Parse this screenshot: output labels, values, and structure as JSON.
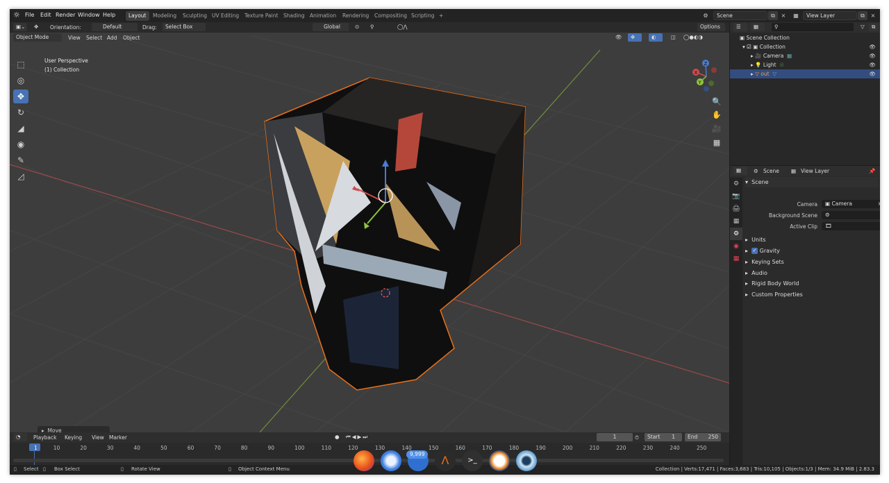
{
  "topbar": {
    "menus": [
      "File",
      "Edit",
      "Render",
      "Window",
      "Help"
    ],
    "workspaces": [
      "Layout",
      "Modeling",
      "Sculpting",
      "UV Editing",
      "Texture Paint",
      "Shading",
      "Animation",
      "Rendering",
      "Compositing",
      "Scripting"
    ],
    "add_tab": "+",
    "scene_field": "Scene",
    "view_layer_field": "View Layer"
  },
  "viewport_header": {
    "orientation_label": "Orientation:",
    "orientation_value": "Default",
    "drag_label": "Drag:",
    "drag_value": "Select Box",
    "transform_value": "Global",
    "options_label": "Options",
    "mode": "Object Mode",
    "menus": [
      "View",
      "Select",
      "Add",
      "Object"
    ]
  },
  "viewport": {
    "perspective": "User Perspective",
    "collection": "(1) Collection",
    "operator_panel": "Move",
    "gizmo": {
      "x": "X",
      "y": "Y",
      "z": "Z"
    },
    "colors": {
      "x_axis": "#c44d4d",
      "y_axis": "#88b04b",
      "selection": "#e8701a",
      "grid": "#4a4a4a"
    }
  },
  "outliner": {
    "root": "Scene Collection",
    "collection": "Collection",
    "items": [
      {
        "name": "Camera",
        "selected": false
      },
      {
        "name": "Light",
        "selected": false
      },
      {
        "name": "out",
        "selected": true
      }
    ]
  },
  "properties": {
    "header_scene": "Scene",
    "header_view_layer": "View Layer",
    "panel_title": "Scene",
    "fields": [
      {
        "label": "Camera",
        "value": "Camera"
      },
      {
        "label": "Background Scene",
        "value": ""
      },
      {
        "label": "Active Clip",
        "value": ""
      }
    ],
    "subpanels": [
      "Units",
      "Gravity",
      "Keying Sets",
      "Audio",
      "Rigid Body World",
      "Custom Properties"
    ],
    "gravity_checked": true
  },
  "timeline": {
    "menus": [
      "Playback",
      "Keying",
      "View",
      "Marker"
    ],
    "current_frame": "1",
    "start_label": "Start",
    "start_value": "1",
    "end_label": "End",
    "end_value": "250",
    "ticks": [
      "1",
      "10",
      "20",
      "30",
      "40",
      "50",
      "60",
      "70",
      "80",
      "90",
      "100",
      "110",
      "120",
      "130",
      "140",
      "150",
      "160",
      "170",
      "180",
      "190",
      "200",
      "210",
      "220",
      "230",
      "240",
      "250"
    ]
  },
  "statusbar": {
    "select": "Select",
    "box_select": "Box Select",
    "rotate_view": "Rotate View",
    "context_menu": "Object Context Menu",
    "stats": "Collection | Verts:17,471 | Faces:3,683 | Tris:10,105 | Objects:1/3 | Mem: 34.9 MiB | 2.83.3"
  },
  "dock": {
    "badge": "9,999"
  }
}
